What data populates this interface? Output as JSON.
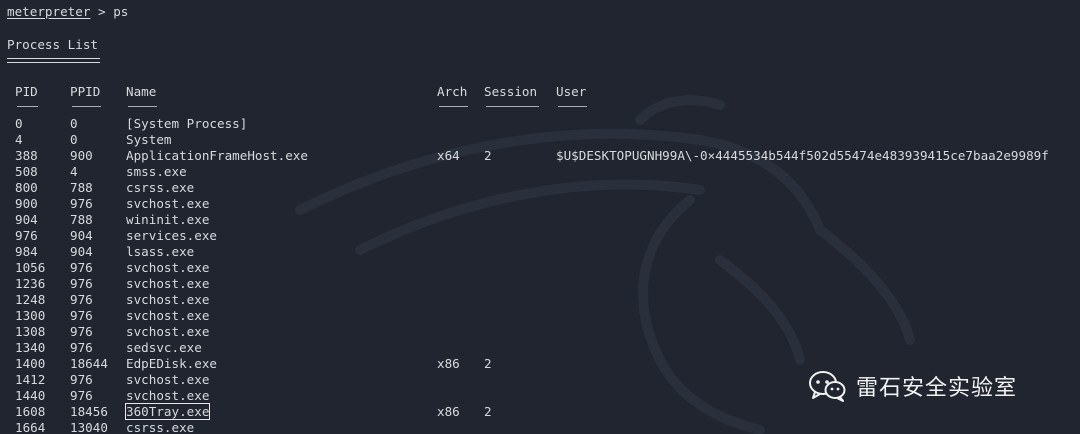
{
  "prompt": {
    "name": "meterpreter",
    "symbol": ">",
    "command": "ps"
  },
  "section_title": "Process List",
  "columns": {
    "pid": "PID",
    "ppid": "PPID",
    "name": "Name",
    "arch": "Arch",
    "session": "Session",
    "user": "User"
  },
  "rows": [
    {
      "pid": "0",
      "ppid": "0",
      "name": "[System Process]",
      "arch": "",
      "session": "",
      "user": ""
    },
    {
      "pid": "4",
      "ppid": "0",
      "name": "System",
      "arch": "",
      "session": "",
      "user": ""
    },
    {
      "pid": "388",
      "ppid": "900",
      "name": "ApplicationFrameHost.exe",
      "arch": "x64",
      "session": "2",
      "user": "$U$DESKTOPUGNH99A\\-0×4445534b544f502d55474e483939415ce7baa2e9989f"
    },
    {
      "pid": "508",
      "ppid": "4",
      "name": "smss.exe",
      "arch": "",
      "session": "",
      "user": ""
    },
    {
      "pid": "800",
      "ppid": "788",
      "name": "csrss.exe",
      "arch": "",
      "session": "",
      "user": ""
    },
    {
      "pid": "900",
      "ppid": "976",
      "name": "svchost.exe",
      "arch": "",
      "session": "",
      "user": ""
    },
    {
      "pid": "904",
      "ppid": "788",
      "name": "wininit.exe",
      "arch": "",
      "session": "",
      "user": ""
    },
    {
      "pid": "976",
      "ppid": "904",
      "name": "services.exe",
      "arch": "",
      "session": "",
      "user": ""
    },
    {
      "pid": "984",
      "ppid": "904",
      "name": "lsass.exe",
      "arch": "",
      "session": "",
      "user": ""
    },
    {
      "pid": "1056",
      "ppid": "976",
      "name": "svchost.exe",
      "arch": "",
      "session": "",
      "user": ""
    },
    {
      "pid": "1236",
      "ppid": "976",
      "name": "svchost.exe",
      "arch": "",
      "session": "",
      "user": ""
    },
    {
      "pid": "1248",
      "ppid": "976",
      "name": "svchost.exe",
      "arch": "",
      "session": "",
      "user": ""
    },
    {
      "pid": "1300",
      "ppid": "976",
      "name": "svchost.exe",
      "arch": "",
      "session": "",
      "user": ""
    },
    {
      "pid": "1308",
      "ppid": "976",
      "name": "svchost.exe",
      "arch": "",
      "session": "",
      "user": ""
    },
    {
      "pid": "1340",
      "ppid": "976",
      "name": "sedsvc.exe",
      "arch": "",
      "session": "",
      "user": ""
    },
    {
      "pid": "1400",
      "ppid": "18644",
      "name": "EdpEDisk.exe",
      "arch": "x86",
      "session": "2",
      "user": ""
    },
    {
      "pid": "1412",
      "ppid": "976",
      "name": "svchost.exe",
      "arch": "",
      "session": "",
      "user": ""
    },
    {
      "pid": "1440",
      "ppid": "976",
      "name": "svchost.exe",
      "arch": "",
      "session": "",
      "user": ""
    },
    {
      "pid": "1608",
      "ppid": "18456",
      "name": "360Tray.exe",
      "arch": "x86",
      "session": "2",
      "user": "",
      "highlighted": true
    },
    {
      "pid": "1664",
      "ppid": "13040",
      "name": "csrss.exe",
      "arch": "",
      "session": "",
      "user": ""
    }
  ],
  "watermark": {
    "text": "雷石安全实验室",
    "icon": "wechat-icon"
  },
  "colors": {
    "background": "#20252f",
    "text": "#d8dade",
    "highlight_border": "#e8e8e8"
  }
}
